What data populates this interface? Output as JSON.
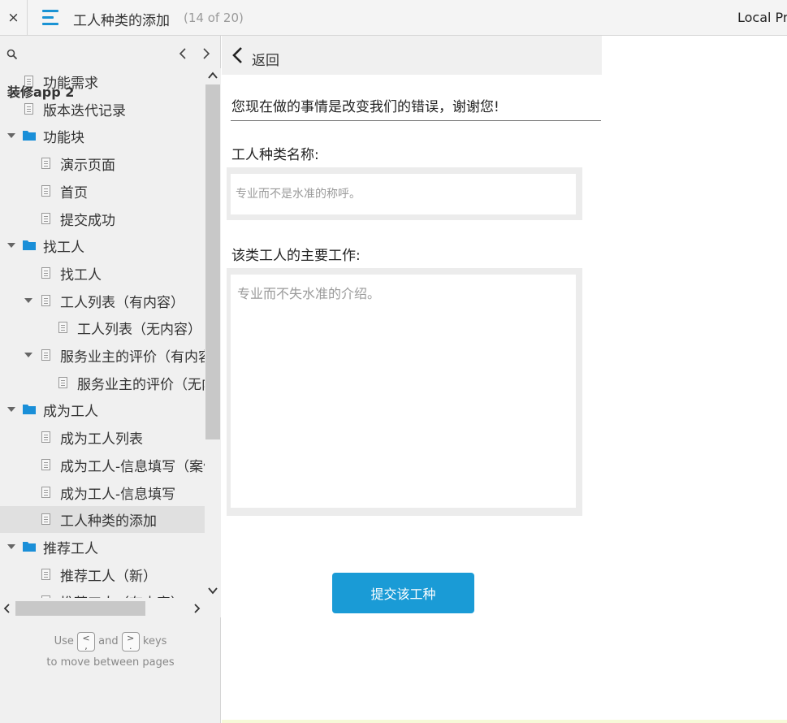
{
  "topbar": {
    "close_label": "×",
    "title": "工人种类的添加",
    "page_count": "(14 of 20)",
    "local_preview": "Local Pre"
  },
  "sidebar": {
    "project_title": "装修app 2",
    "items": [
      {
        "label": "功能需求",
        "type": "page",
        "depth": 0
      },
      {
        "label": "版本迭代记录",
        "type": "page",
        "depth": 0
      },
      {
        "label": "功能块",
        "type": "folder",
        "depth": 0
      },
      {
        "label": "演示页面",
        "type": "page",
        "depth": 1
      },
      {
        "label": "首页",
        "type": "page",
        "depth": 1
      },
      {
        "label": "提交成功",
        "type": "page",
        "depth": 1
      },
      {
        "label": "找工人",
        "type": "folder",
        "depth": 0
      },
      {
        "label": "找工人",
        "type": "page",
        "depth": 1
      },
      {
        "label": "工人列表（有内容）",
        "type": "page",
        "depth": 1,
        "expanded": true
      },
      {
        "label": "工人列表（无内容）",
        "type": "page",
        "depth": 2
      },
      {
        "label": "服务业主的评价（有内容）",
        "type": "page",
        "depth": 1,
        "expanded": true
      },
      {
        "label": "服务业主的评价（无内容）",
        "type": "page",
        "depth": 2
      },
      {
        "label": "成为工人",
        "type": "folder",
        "depth": 0
      },
      {
        "label": "成为工人列表",
        "type": "page",
        "depth": 1
      },
      {
        "label": "成为工人-信息填写（案例）",
        "type": "page",
        "depth": 1
      },
      {
        "label": "成为工人-信息填写",
        "type": "page",
        "depth": 1
      },
      {
        "label": "工人种类的添加",
        "type": "page",
        "depth": 1,
        "selected": true
      },
      {
        "label": "推荐工人",
        "type": "folder",
        "depth": 0
      },
      {
        "label": "推荐工人（新）",
        "type": "page",
        "depth": 1
      },
      {
        "label": "推荐工人（有内容）",
        "type": "page",
        "depth": 1
      }
    ],
    "hint": {
      "use": "Use",
      "prev_key": "<\n,",
      "and": "and",
      "next_key": ">\n.",
      "keys": "keys",
      "line2": "to move between pages"
    }
  },
  "main": {
    "back_label": "返回",
    "notice": "您现在做的事情是改变我们的错误，谢谢您!",
    "name_label": "工人种类名称:",
    "name_placeholder": "专业而不是水准的称呼。",
    "desc_label": "该类工人的主要工作:",
    "desc_placeholder": "专业而不失水准的介绍。",
    "submit_label": "提交该工种"
  },
  "colors": {
    "accent": "#1a9bd6",
    "menu_icon": "#1a93d4",
    "folder": "#1a8fd8",
    "sidebar_bg": "#f0f0f0",
    "selected_bg": "#e0e0e0"
  }
}
